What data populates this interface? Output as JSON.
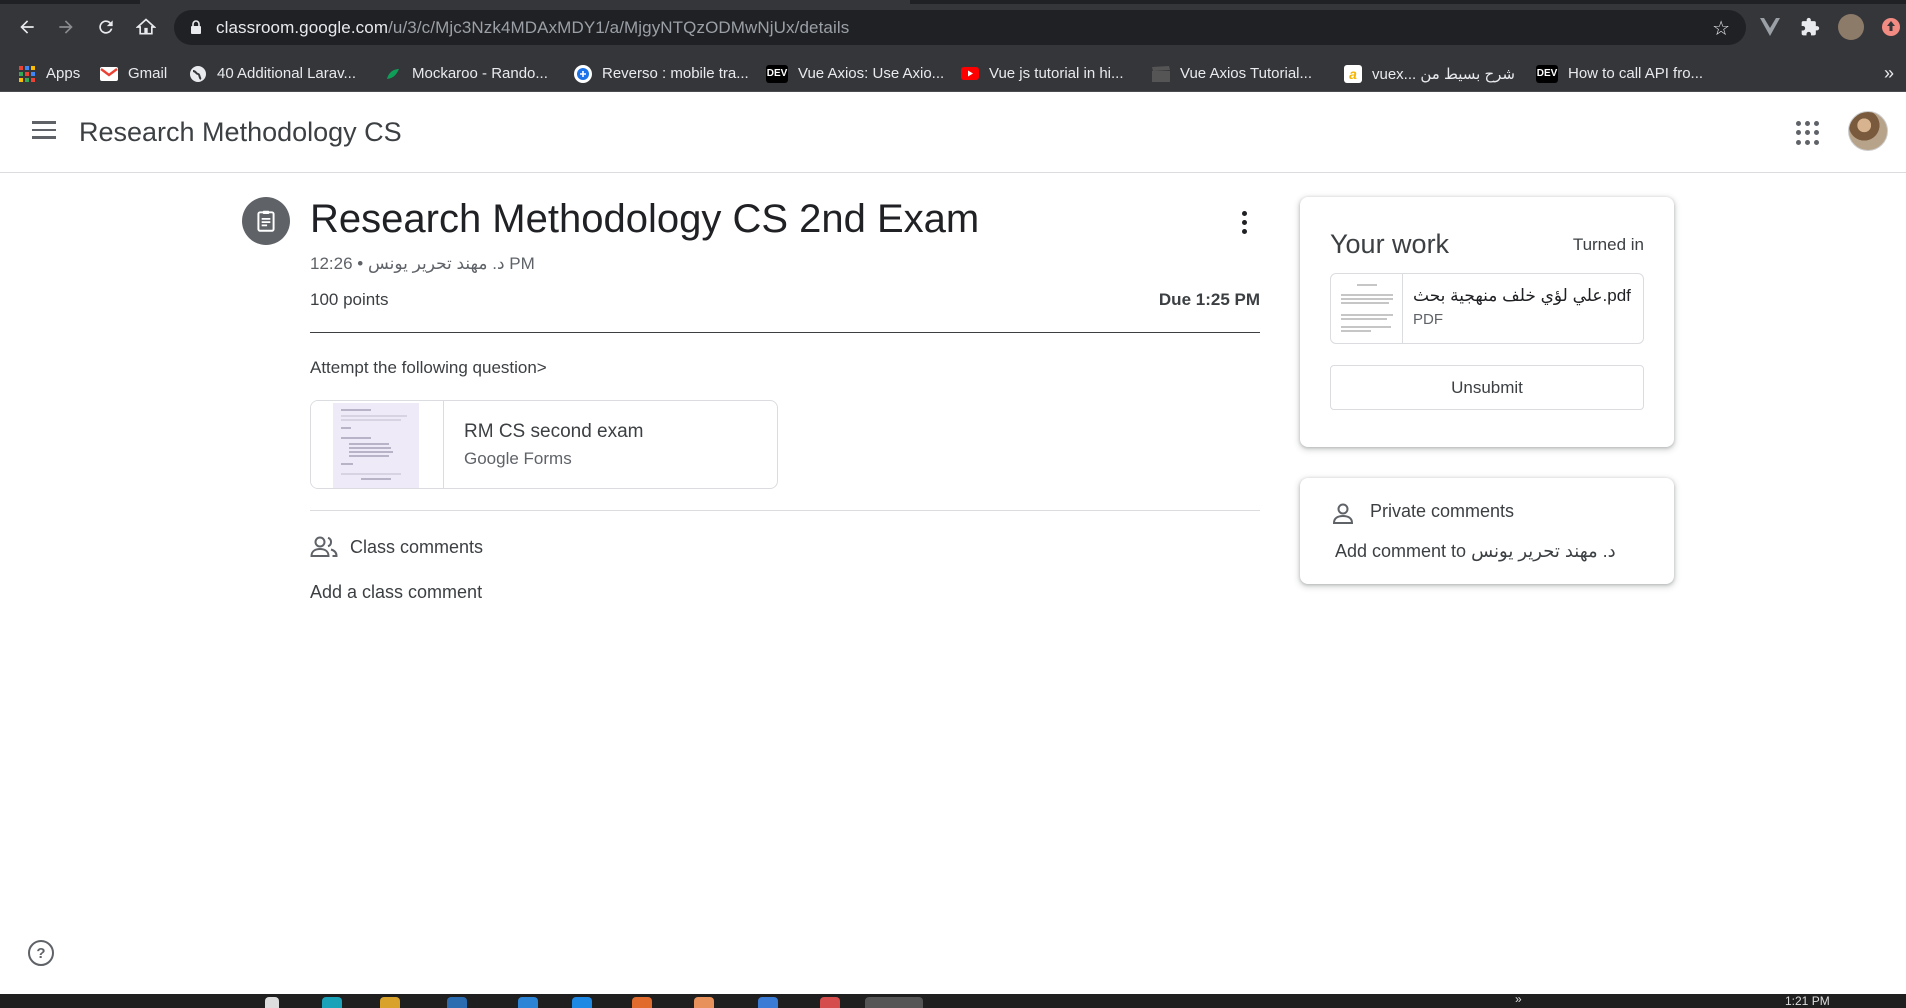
{
  "browser": {
    "url_host": "classroom.google.com",
    "url_path": "/u/3/c/Mjc3Nzk4MDAxMDY1/a/MjgyNTQzODMwNjUx/details",
    "bookmarks": [
      {
        "label": "Apps",
        "icon": "apps-grid-icon",
        "color": "#ea4335"
      },
      {
        "label": "Gmail",
        "icon": "gmail-icon",
        "color": "#ea4335"
      },
      {
        "label": "40 Additional Larav...",
        "icon": "globe-icon",
        "color": "#e8eaed"
      },
      {
        "label": "Mockaroo - Rando...",
        "icon": "mockaroo-icon",
        "color": "#0f9d58"
      },
      {
        "label": "Reverso : mobile tra...",
        "icon": "reverso-icon",
        "color": "#1a73e8"
      },
      {
        "label": "Vue Axios: Use Axio...",
        "icon": "dev-icon",
        "color": "#000000"
      },
      {
        "label": "Vue js tutorial in hi...",
        "icon": "youtube-icon",
        "color": "#ff0000"
      },
      {
        "label": "Vue Axios Tutorial...",
        "icon": "clapper-icon",
        "color": "#333333"
      },
      {
        "label": "vuex... شرح بسيط من",
        "icon": "hsoub-icon",
        "color": "#f4b400"
      },
      {
        "label": "How to call API fro...",
        "icon": "dev-icon",
        "color": "#000000"
      }
    ],
    "more_bookmarks": "»"
  },
  "header": {
    "class_title": "Research Methodology CS"
  },
  "assignment": {
    "title": "Research Methodology CS 2nd Exam",
    "meta": "د. مهند تحرير يونس • 12:26 PM",
    "points": "100 points",
    "due": "Due 1:25 PM",
    "instructions": "Attempt the following question>",
    "attachment": {
      "title": "RM CS second exam",
      "subtitle": "Google Forms"
    }
  },
  "class_comments": {
    "label": "Class comments",
    "add_label": "Add a class comment"
  },
  "your_work": {
    "title": "Your work",
    "status": "Turned in",
    "file_name": "علي لؤي خلف منهجية بحث.pdf",
    "file_type": "PDF",
    "unsubmit_label": "Unsubmit"
  },
  "private_comments": {
    "label": "Private comments",
    "add_label": "Add comment to د. مهند تحرير يونس"
  },
  "taskbar": {
    "time": "1:21 PM",
    "chevron": "»"
  },
  "colors": {
    "chrome_bg": "#35363a",
    "text_primary": "#3c4043",
    "text_secondary": "#5f6368",
    "divider": "#dadce0"
  }
}
